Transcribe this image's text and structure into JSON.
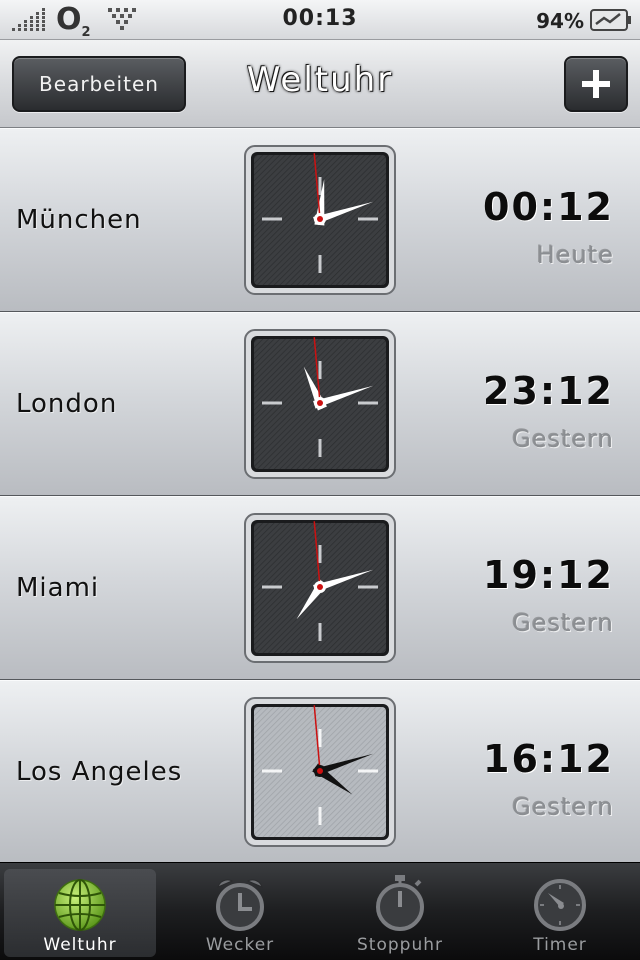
{
  "status_bar": {
    "carrier": "O",
    "carrier_sub": "2",
    "time": "00:13",
    "battery": "94%"
  },
  "nav": {
    "edit_label": "Bearbeiten",
    "title": "Weltuhr",
    "add_icon": "plus-icon"
  },
  "cities": [
    {
      "name": "München",
      "time": "00:12",
      "day": "Heute",
      "face": "dark"
    },
    {
      "name": "London",
      "time": "23:12",
      "day": "Gestern",
      "face": "dark"
    },
    {
      "name": "Miami",
      "time": "19:12",
      "day": "Gestern",
      "face": "dark"
    },
    {
      "name": "Los Angeles",
      "time": "16:12",
      "day": "Gestern",
      "face": "light"
    }
  ],
  "tabs": [
    {
      "label": "Weltuhr",
      "icon": "globe-icon",
      "active": true
    },
    {
      "label": "Wecker",
      "icon": "alarm-clock-icon",
      "active": false
    },
    {
      "label": "Stoppuhr",
      "icon": "stopwatch-icon",
      "active": false
    },
    {
      "label": "Timer",
      "icon": "timer-icon",
      "active": false
    }
  ],
  "colors": {
    "second_hand": "#cc1111",
    "globe": "#8cc63f"
  }
}
